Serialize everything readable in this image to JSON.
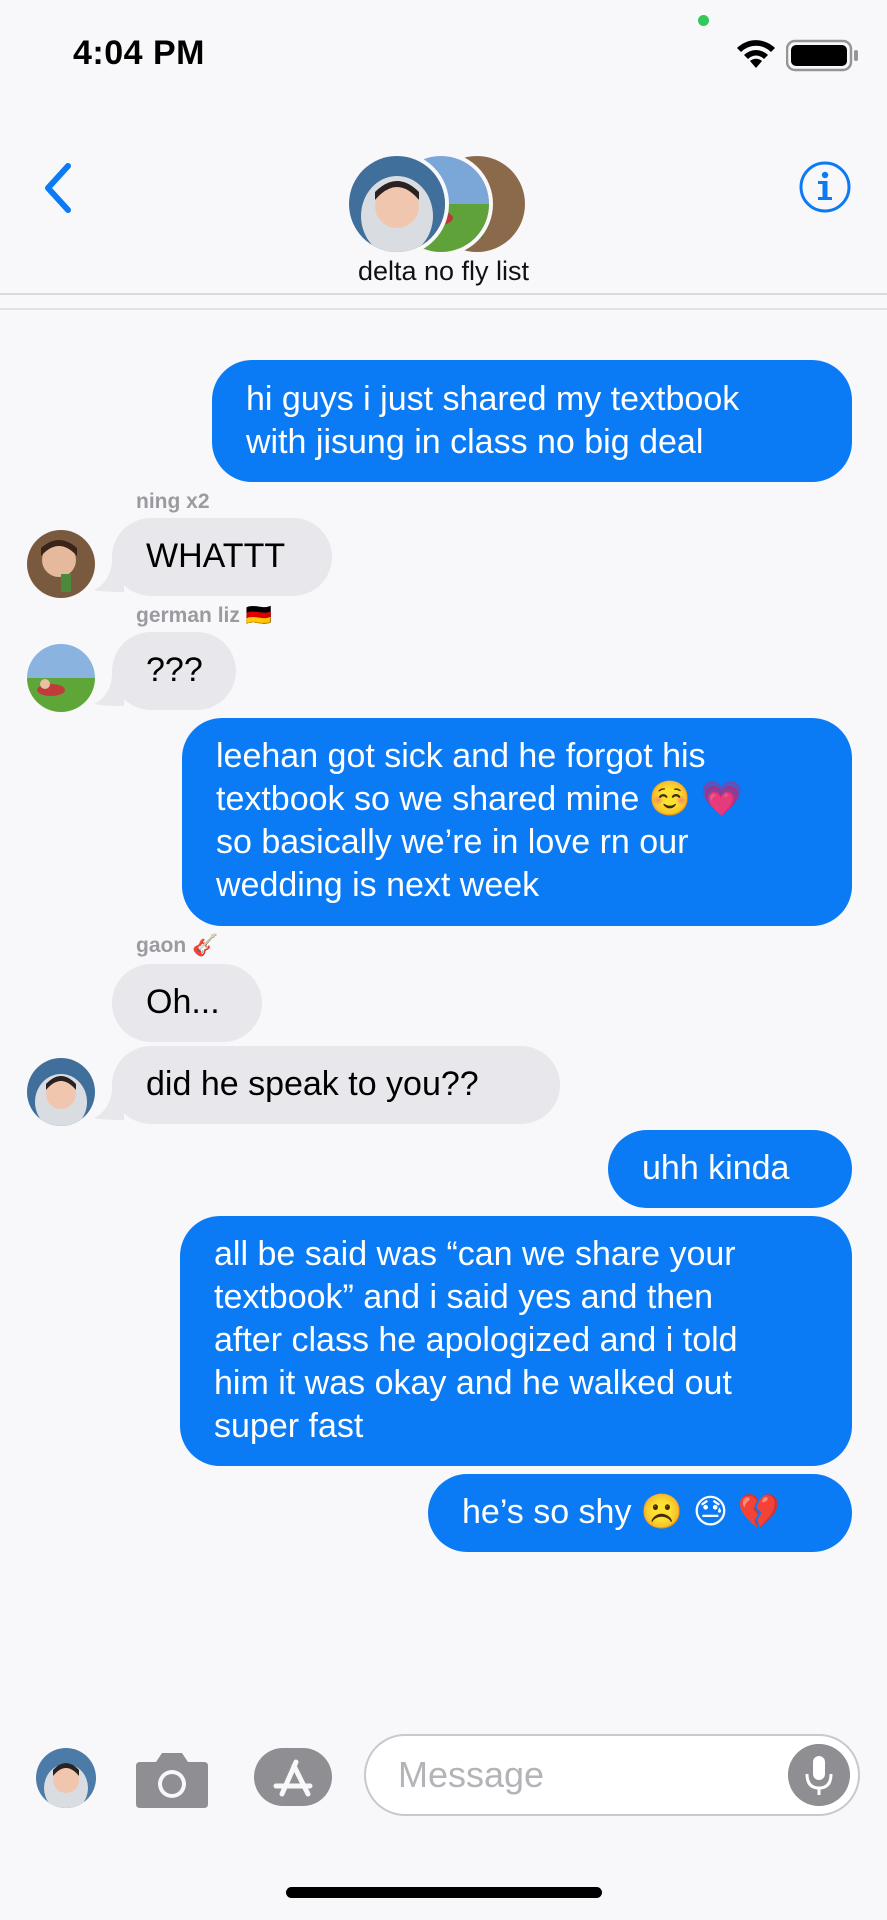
{
  "status_bar": {
    "time": "4:04 PM"
  },
  "header": {
    "group_name": "delta no fly list",
    "back_icon": "chevron-left-icon",
    "info_icon": "info-circle-icon"
  },
  "messages": [
    {
      "type": "outgoing",
      "text": "hi guys i just shared my textbook\nwith jisung in class no big deal"
    },
    {
      "type": "incoming",
      "sender": "ning x2",
      "text": "WHATTT"
    },
    {
      "type": "incoming",
      "sender": "german liz 🇩🇪",
      "text": "???"
    },
    {
      "type": "outgoing",
      "text": "leehan got sick and he forgot his\ntextbook so we shared mine ☺️ 💗\nso basically we’re in love rn our\nwedding is next week"
    },
    {
      "type": "incoming",
      "sender": "gaon 🎸",
      "text": "Oh..."
    },
    {
      "type": "incoming",
      "text": "did he speak to you??"
    },
    {
      "type": "outgoing",
      "text": "uhh kinda"
    },
    {
      "type": "outgoing",
      "text": "all be said was “can we share your\ntextbook” and i said yes and then\nafter class he apologized and i told\nhim it was okay and he walked out\nsuper fast"
    },
    {
      "type": "outgoing",
      "text": "he’s so shy ☹️ 😓 💔"
    }
  ],
  "input_bar": {
    "placeholder": "Message",
    "camera_icon": "camera-icon",
    "apps_icon": "app-store-icon",
    "mic_icon": "microphone-icon"
  },
  "colors": {
    "outgoing_bubble": "#0b7bf5",
    "incoming_bubble": "#e8e7ec",
    "accent": "#0b7bf5",
    "background": "#f8f8fa"
  }
}
